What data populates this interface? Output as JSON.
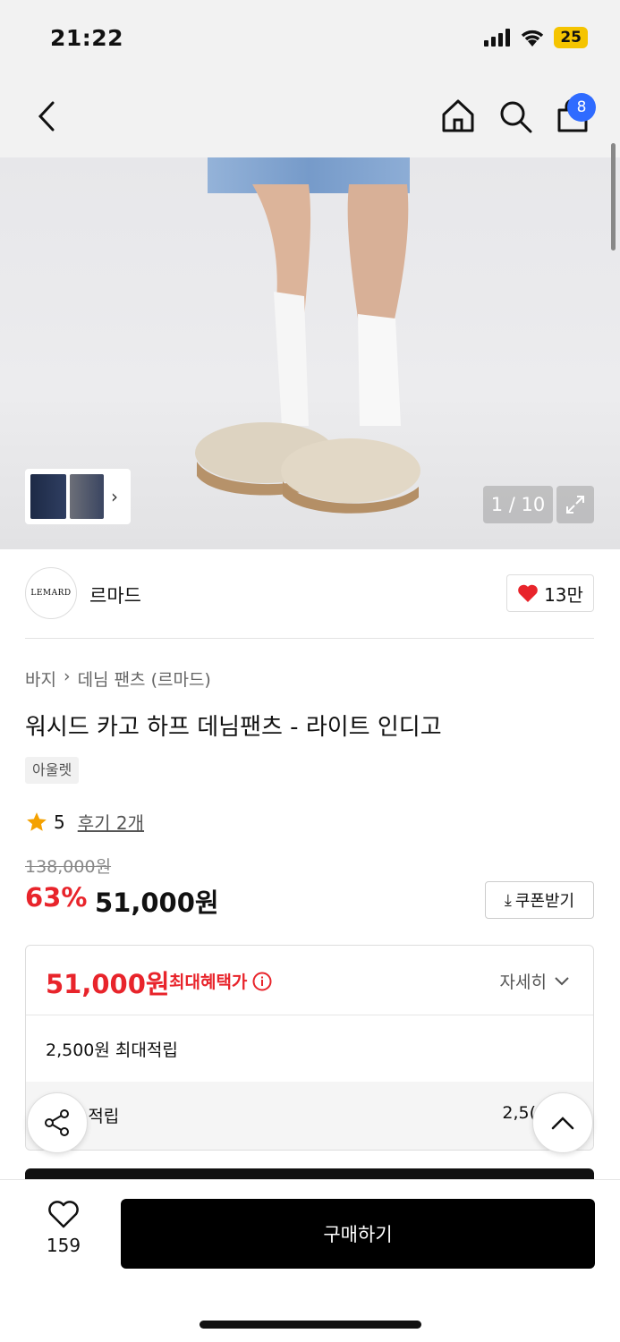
{
  "status_bar": {
    "time": "21:22",
    "battery": "25"
  },
  "nav": {
    "cart_count": "8"
  },
  "gallery": {
    "counter": "1 / 10"
  },
  "brand": {
    "logo_text": "LEMARD",
    "name": "르마드",
    "likes": "13만"
  },
  "breadcrumb": {
    "category": "바지",
    "sub_category": "데님 팬츠 (르마드)"
  },
  "product": {
    "title": "워시드 카고 하프 데님팬츠 - 라이트 인디고",
    "tag": "아울렛",
    "rating": "5",
    "reviews": "후기 2개",
    "original_price": "138,000원",
    "discount": "63%",
    "sale_price": "51,000원",
    "coupon_label": "쿠폰받기"
  },
  "benefit": {
    "max_price": "51,000원",
    "max_price_label": "최대혜택가",
    "detail_label": "자세히",
    "points_summary": "2,500원 최대적립",
    "points_row_label": "l 적립",
    "points_row_value": "2,5("
  },
  "bottom": {
    "wish_count": "159",
    "buy_label": "구매하기"
  },
  "colors": {
    "accent_red": "#e8242b",
    "badge_blue": "#2f6bff",
    "rating_star": "#f4a100"
  }
}
